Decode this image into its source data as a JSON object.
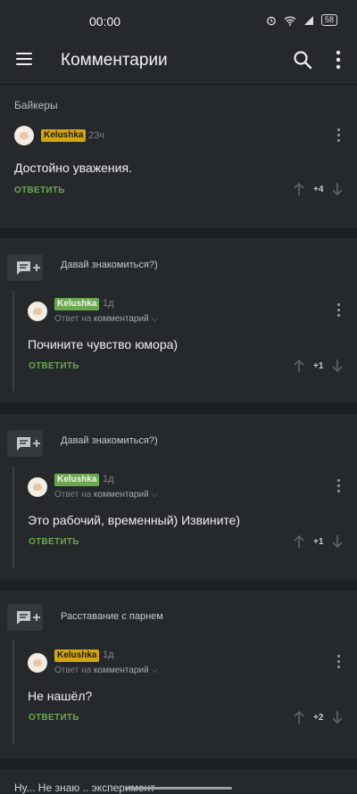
{
  "status_bar": {
    "time": "00:00",
    "battery": "58"
  },
  "app_bar": {
    "title": "Комментарии"
  },
  "post": {
    "title": "Байкеры",
    "comment": {
      "author": "Kelushka",
      "time": "23ч",
      "text": "Достойно уважения.",
      "reply_label": "ОТВЕТИТЬ",
      "score": "+4"
    }
  },
  "threads": [
    {
      "parent_text": "Давай знакомиться?)",
      "reply": {
        "author": "Kelushka",
        "time": "1д",
        "reply_to_prefix": "Ответ на",
        "reply_to_target": "комментарий",
        "text": "Почините чувство юмора)",
        "reply_label": "ОТВЕТИТЬ",
        "score": "+1"
      }
    },
    {
      "parent_text": "Давай знакомиться?)",
      "reply": {
        "author": "Kelushka",
        "time": "1д",
        "reply_to_prefix": "Ответ на",
        "reply_to_target": "комментарий",
        "text": "Это рабочий, временный) Извините)",
        "reply_label": "ОТВЕТИТЬ",
        "score": "+1"
      }
    },
    {
      "parent_text": "Расставание с парнем",
      "reply": {
        "author": "Kelushka",
        "time": "1д",
        "reply_to_prefix": "Ответ на",
        "reply_to_target": "комментарий",
        "text": "Не нашёл?",
        "reply_label": "ОТВЕТИТЬ",
        "score": "+2"
      }
    }
  ],
  "bottom_post": {
    "title": "Ну... Не знаю .. эксперимент"
  },
  "colors": {
    "accent_green": "#6aa84f",
    "badge_gold": "#d4a512",
    "background": "#1c1f22",
    "card": "#26292c"
  }
}
